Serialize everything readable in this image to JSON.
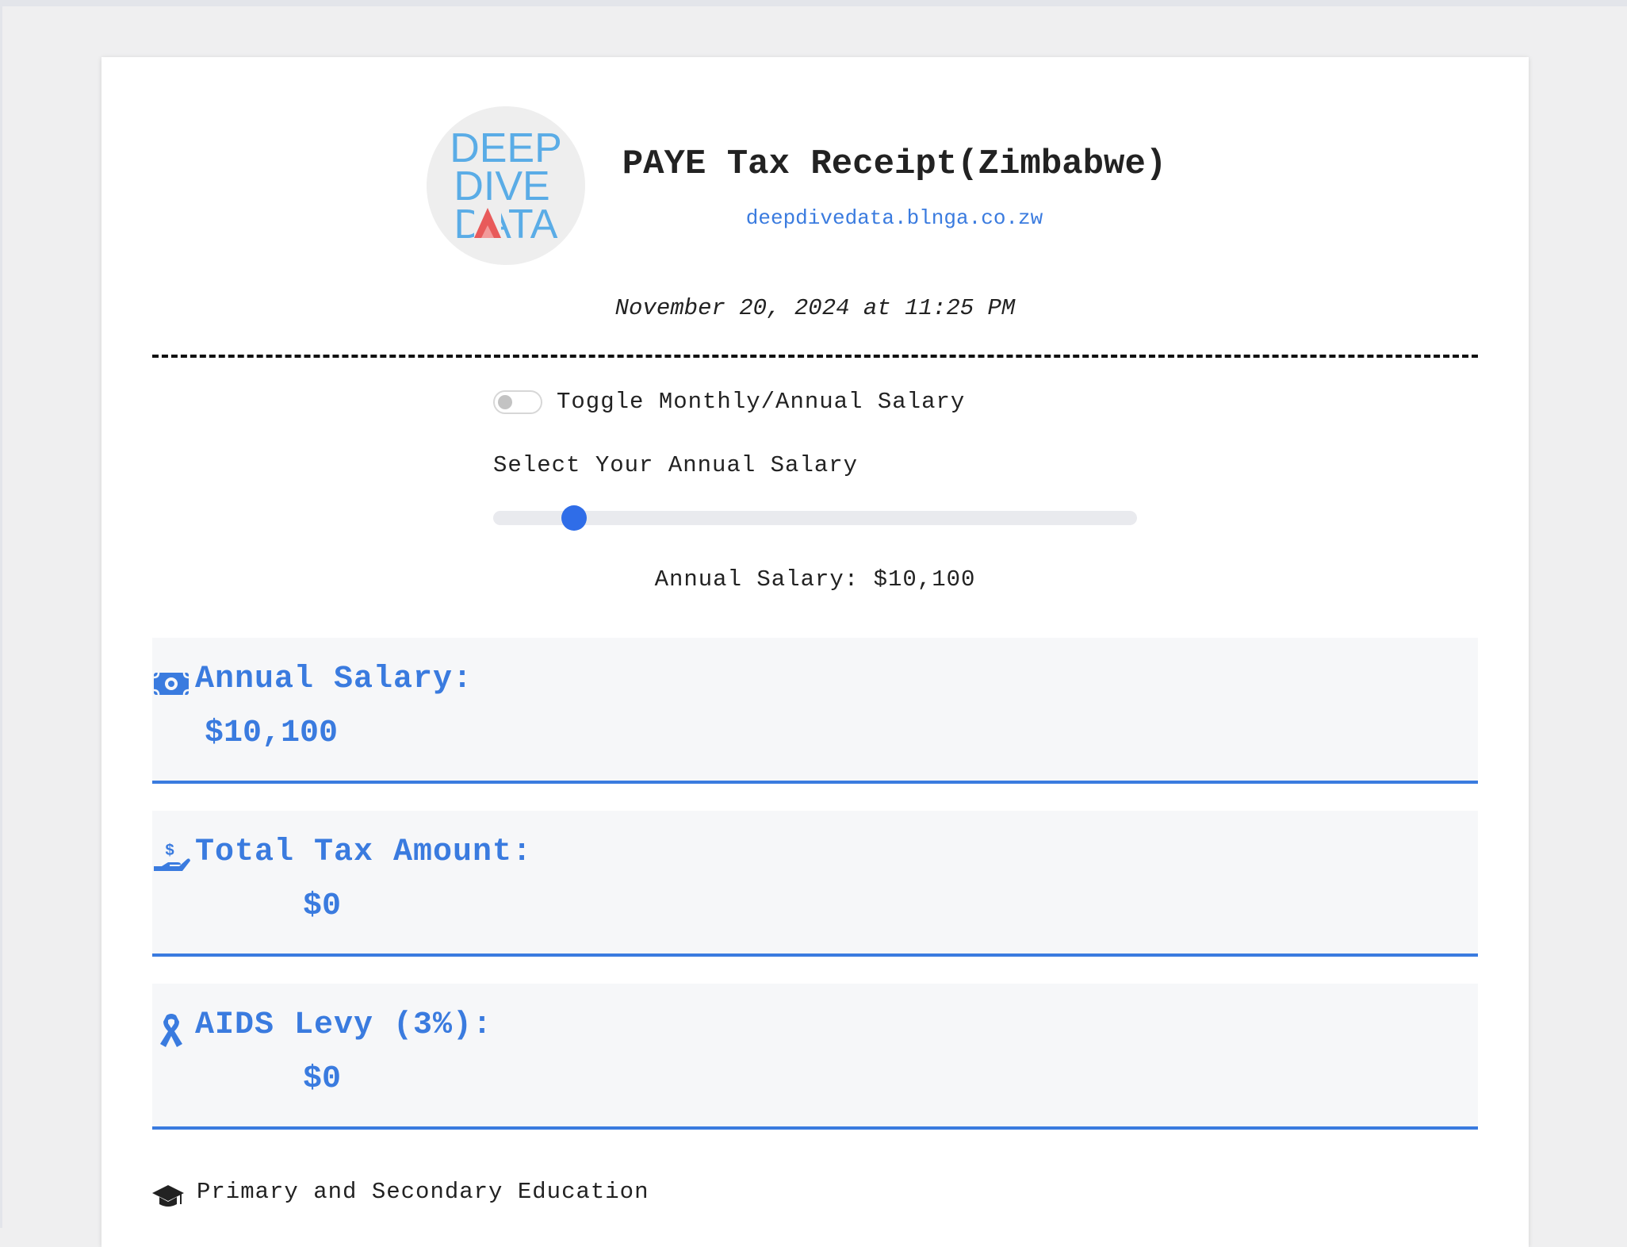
{
  "header": {
    "logo": {
      "line1": "DEEP",
      "line2": "DIVE",
      "line3": "DATA"
    },
    "title": "PAYE Tax Receipt(Zimbabwe)",
    "website": "deepdivedata.blnga.co.zw"
  },
  "date": "November 20, 2024 at 11:25 PM",
  "controls": {
    "toggle_label": "Toggle Monthly/Annual Salary",
    "toggle_on": false,
    "slider_label": "Select Your Annual Salary",
    "slider_fraction": 0.11,
    "readout": "Annual Salary: $10,100"
  },
  "cards": [
    {
      "icon": "money-bill-icon",
      "label": "Annual Salary:",
      "value": "$10,100"
    },
    {
      "icon": "hand-dollar-icon",
      "label": "Total Tax Amount:",
      "value": "$0"
    },
    {
      "icon": "ribbon-icon",
      "label": "AIDS Levy (3%):",
      "value": "$0"
    }
  ],
  "sections": [
    {
      "icon": "graduation-cap-icon",
      "label": "Primary and Secondary Education"
    }
  ],
  "colors": {
    "accent": "#3a7bdf",
    "slider_thumb": "#2f6de8",
    "logo_blue": "#5aace6",
    "logo_red": "#e85a5a",
    "card_bg": "#f6f7f9"
  }
}
